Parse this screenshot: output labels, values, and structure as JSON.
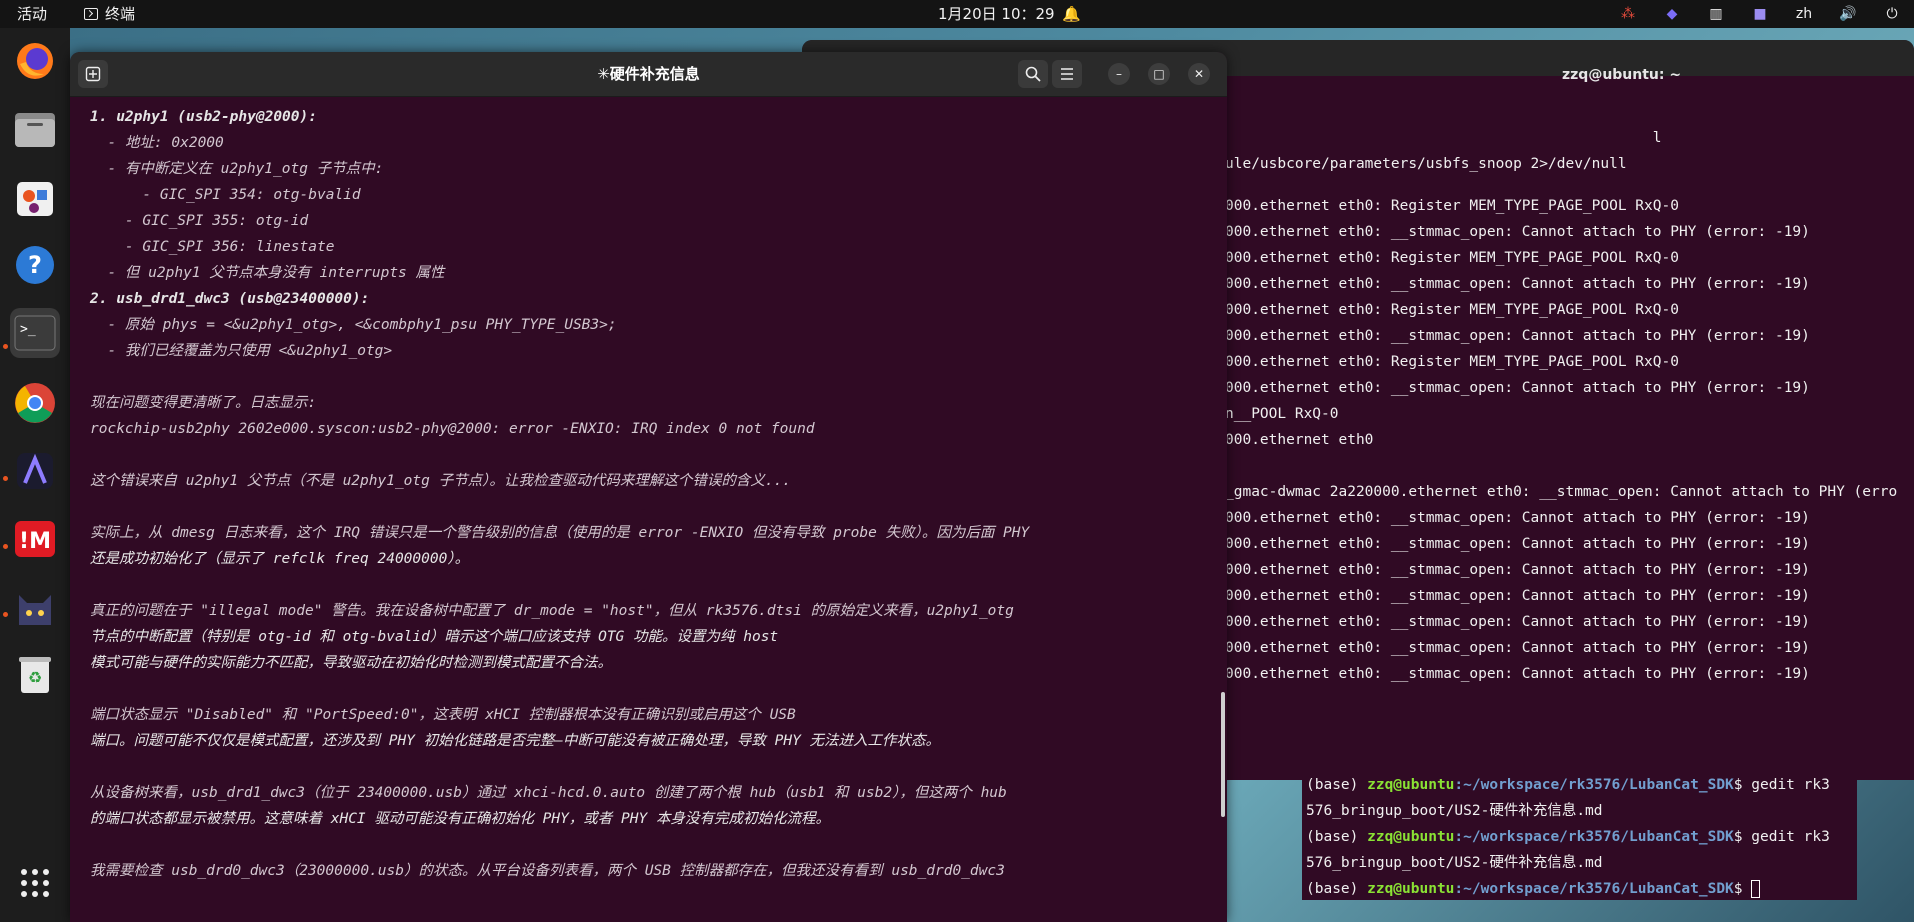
{
  "topbar": {
    "activities": "活动",
    "app_name": "终端",
    "clock": "1月20日  10：29",
    "tray": {
      "input_lang": "zh"
    }
  },
  "dock": {
    "items": [
      "firefox-icon",
      "files-icon",
      "software-center-icon",
      "help-icon",
      "terminal-icon",
      "chrome-icon",
      "app-icon",
      "app-red-icon",
      "cat-app-icon",
      "trash-icon",
      "app-grid-icon"
    ]
  },
  "gedit": {
    "title": "✳硬件补充信息",
    "lines": [
      "1. u2phy1 (usb2-phy@2000):",
      "  - 地址: 0x2000",
      "  - 有中断定义在 u2phy1_otg 子节点中:",
      "      - GIC_SPI 354: otg-bvalid",
      "    - GIC_SPI 355: otg-id",
      "    - GIC_SPI 356: linestate",
      "  - 但 u2phy1 父节点本身没有 interrupts 属性",
      "2. usb_drd1_dwc3 (usb@23400000):",
      "  - 原始 phys = <&u2phy1_otg>, <&combphy1_psu PHY_TYPE_USB3>;",
      "  - 我们已经覆盖为只使用 <&u2phy1_otg>",
      "",
      "现在问题变得更清晰了。日志显示:",
      "rockchip-usb2phy 2602e000.syscon:usb2-phy@2000: error -ENXIO: IRQ index 0 not found",
      "",
      "这个错误来自 u2phy1 父节点（不是 u2phy1_otg 子节点）。让我检查驱动代码来理解这个错误的含义...",
      "",
      "实际上，从 dmesg 日志来看，这个 IRQ 错误只是一个警告级别的信息（使用的是 error -ENXIO 但没有导致 probe 失败）。因为后面 PHY",
      "还是成功初始化了（显示了 refclk freq 24000000）。",
      "",
      "真正的问题在于 \"illegal mode\" 警告。我在设备树中配置了 dr_mode = \"host\"，但从 rk3576.dtsi 的原始定义来看，u2phy1_otg",
      "节点的中断配置（特别是 otg-id 和 otg-bvalid）暗示这个端口应该支持 OTG 功能。设置为纯 host",
      "模式可能与硬件的实际能力不匹配，导致驱动在初始化时检测到模式配置不合法。",
      "",
      "端口状态显示 \"Disabled\" 和 \"PortSpeed:0\"，这表明 xHCI 控制器根本没有正确识别或启用这个 USB",
      "端口。问题可能不仅仅是模式配置，还涉及到 PHY 初始化链路是否完整—中断可能没有被正确处理，导致 PHY 无法进入工作状态。",
      "",
      "从设备树来看，usb_drd1_dwc3（位于 23400000.usb）通过 xhci-hcd.0.auto 创建了两个根 hub（usb1 和 usb2），但这两个 hub",
      "的端口状态都显示被禁用。这意味着 xHCI 驱动可能没有正确初始化 PHY，或者 PHY 本身没有完成初始化流程。",
      "",
      "我需要检查 usb_drd0_dwc3（23000000.usb）的状态。从平台设备列表看，两个 USB 控制器都存在，但我还没有看到 usb_drd0_dwc3"
    ]
  },
  "terminal": {
    "title": "zzq@ubuntu: ~",
    "lines": [
      "",
      "",
      "                                                 l",
      "ule/usbcore/parameters/usbfs_snoop 2>/dev/null",
      "",
      "000.ethernet eth0: Register MEM_TYPE_PAGE_POOL RxQ-0",
      "000.ethernet eth0: __stmmac_open: Cannot attach to PHY (error: -19)",
      "000.ethernet eth0: Register MEM_TYPE_PAGE_POOL RxQ-0",
      "000.ethernet eth0: __stmmac_open: Cannot attach to PHY (error: -19)",
      "000.ethernet eth0: Register MEM_TYPE_PAGE_POOL RxQ-0",
      "000.ethernet eth0: __stmmac_open: Cannot attach to PHY (error: -19)",
      "000.ethernet eth0: Register MEM_TYPE_PAGE_POOL RxQ-0",
      "000.ethernet eth0: __stmmac_open: Cannot attach to PHY (error: -19)",
      "n__POOL RxQ-0",
      "000.ethernet eth0",
      "",
      "_gmac-dwmac 2a220000.ethernet eth0: __stmmac_open: Cannot attach to PHY (erro",
      "000.ethernet eth0: __stmmac_open: Cannot attach to PHY (error: -19)",
      "000.ethernet eth0: __stmmac_open: Cannot attach to PHY (error: -19)",
      "000.ethernet eth0: __stmmac_open: Cannot attach to PHY (error: -19)",
      "000.ethernet eth0: __stmmac_open: Cannot attach to PHY (error: -19)",
      "000.ethernet eth0: __stmmac_open: Cannot attach to PHY (error: -19)",
      "000.ethernet eth0: __stmmac_open: Cannot attach to PHY (error: -19)",
      "000.ethernet eth0: __stmmac_open: Cannot attach to PHY (error: -19)"
    ]
  },
  "terminal2": {
    "prompt_env": "(base) ",
    "prompt_user": "zzq@ubuntu",
    "prompt_path": ":~/workspace/rk3576/LubanCat_SDK",
    "prompt_end": "$ ",
    "cmd1": "gedit rk3",
    "cont1": "576_bringup_boot/US2-硬件补充信息.md",
    "cmd2": "gedit rk3",
    "cont2": "576_bringup_boot/US2-硬件补充信息.md"
  }
}
